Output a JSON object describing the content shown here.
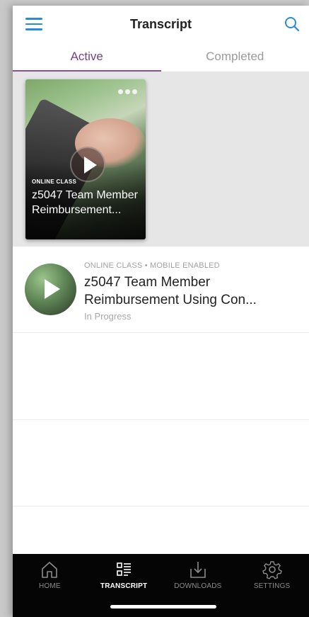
{
  "header": {
    "title": "Transcript"
  },
  "tabs": [
    {
      "label": "Active",
      "active": true
    },
    {
      "label": "Completed",
      "active": false
    }
  ],
  "featured_card": {
    "type_label": "ONLINE CLASS",
    "title": "z5047 Team Member Reimbursement..."
  },
  "list": [
    {
      "meta": "ONLINE CLASS • MOBILE ENABLED",
      "title": "z5047 Team Member Reimbursement Using Con...",
      "status": "In Progress"
    }
  ],
  "bottom_nav": [
    {
      "label": "HOME",
      "icon": "home-icon",
      "selected": false
    },
    {
      "label": "TRANSCRIPT",
      "icon": "transcript-icon",
      "selected": true
    },
    {
      "label": "DOWNLOADS",
      "icon": "downloads-icon",
      "selected": false
    },
    {
      "label": "SETTINGS",
      "icon": "settings-gear-icon",
      "selected": false
    }
  ],
  "colors": {
    "accent_blue": "#2a8bd6",
    "active_tab": "#7a3f86",
    "nav_background": "#050505"
  }
}
